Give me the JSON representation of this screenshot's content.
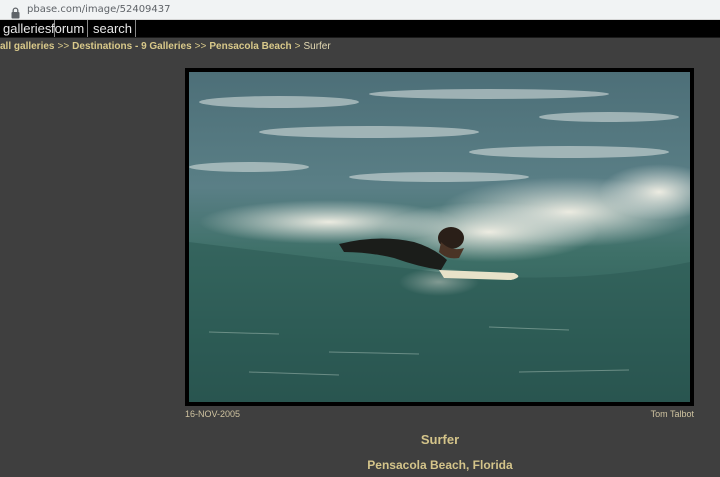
{
  "browser": {
    "url": "pbase.com/image/52409437"
  },
  "nav": {
    "items": [
      "galleries",
      "forum",
      "search"
    ]
  },
  "breadcrumb": {
    "links": [
      "all galleries",
      "Destinations - 9 Galleries",
      "Pensacola Beach"
    ],
    "separator_double": ">>",
    "separator_single": ">",
    "current": "Surfer"
  },
  "image": {
    "date": "16-NOV-2005",
    "author": "Tom Talbot",
    "title": "Surfer",
    "caption": "Pensacola Beach, Florida"
  },
  "colors": {
    "page_bg": "#3f3f3f",
    "accent_text": "#d4c48a",
    "navbar_bg": "#000000"
  }
}
